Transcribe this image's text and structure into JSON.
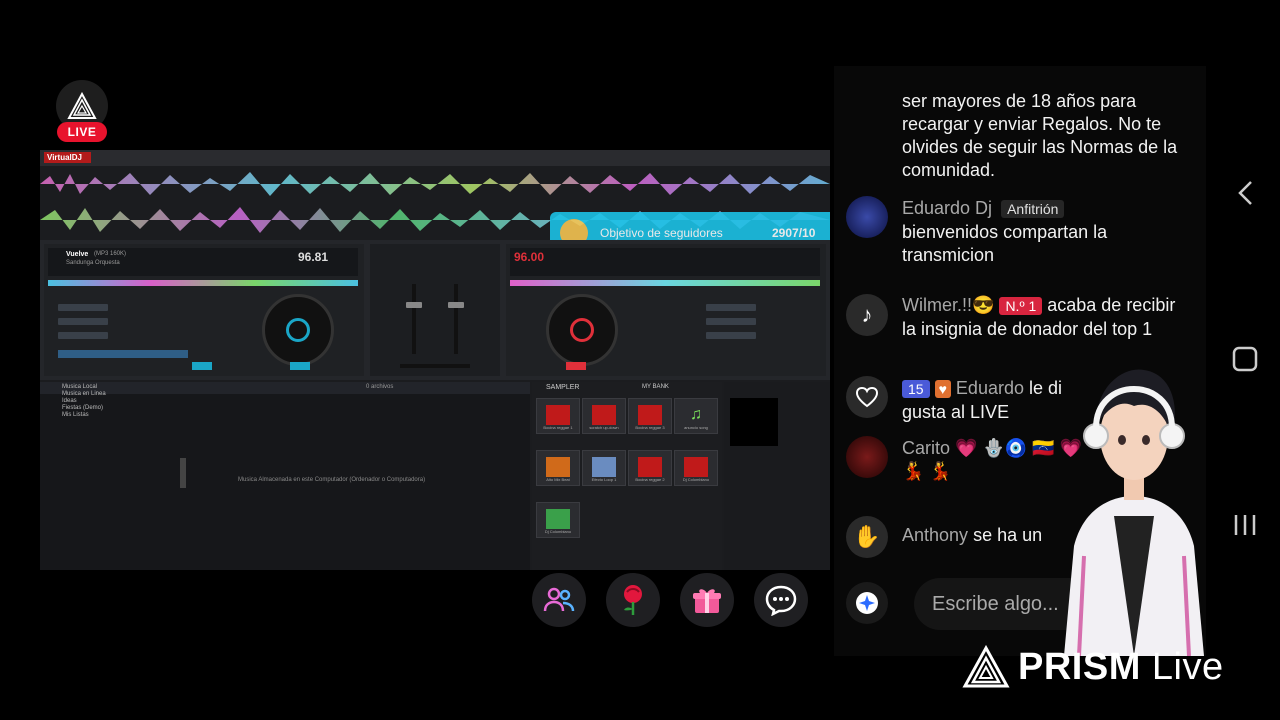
{
  "live_badge": {
    "label": "LIVE"
  },
  "dj_app": {
    "logo": "VirtualDJ",
    "deck_left": {
      "title": "Vuelve",
      "format": "(MP3 160K)",
      "artist": "Sandunga Orquesta",
      "bpm": "96.81"
    },
    "deck_right": {
      "bpm": "96.00"
    },
    "follow_goal": {
      "label": "Objetivo de seguidores",
      "progress": "2907/10"
    },
    "browser": {
      "tree": [
        "Musica Local",
        "Musica en Linea",
        "Ideas",
        "Fiestas (Demo)",
        "Mis Listas"
      ],
      "empty_message": "Musica Almacenada en este Computador (Ordenador o Computadora)",
      "results_label": "0 archivos"
    },
    "sampler": {
      "header": "SAMPLER",
      "bank": "MY BANK",
      "pads": [
        "Bocina reggae 1",
        "scratch up-down",
        "Bocina reggae 3",
        "anuncio song",
        "Alto Mix Beat",
        "Efecto Loop 1",
        "Bocina reggae 2",
        "Dj Colombiano",
        "Dj Colombiano"
      ]
    }
  },
  "actions": [
    {
      "name": "guests-button",
      "icon": "users-icon"
    },
    {
      "name": "rose-button",
      "icon": "rose-icon"
    },
    {
      "name": "gift-button",
      "icon": "gift-icon"
    },
    {
      "name": "comment-button",
      "icon": "chat-bubble-icon"
    }
  ],
  "chat": {
    "system_notice": "ser mayores de 18 años para recargar y enviar Regalos. No te olvides de seguir las Normas de la comunidad.",
    "messages": [
      {
        "user": "Eduardo Dj",
        "badge": "Anfitrión",
        "text": "bienvenidos compartan la transmicion"
      },
      {
        "user": "Wilmer.!!😎",
        "badge": "N.º 1",
        "text": "acaba de recibir la insignia de donador del top 1"
      },
      {
        "level": "15",
        "user": "Eduardo",
        "text": "le di",
        "text2": "gusta al LIVE"
      },
      {
        "user": "Carito",
        "text": "💗 🪬🧿 🇻🇪 💗",
        "text2": "💃 💃"
      },
      {
        "user": "Anthony",
        "text": "se ha un"
      }
    ],
    "input_placeholder": "Escribe algo..."
  },
  "watermark": {
    "brand": "PRISM",
    "suffix": "Live"
  },
  "colors": {
    "live_red": "#e8132d",
    "goal_cyan": "#1cc2e6",
    "deck_left_accent": "#1aa6c7",
    "deck_right_accent": "#e0303a"
  }
}
